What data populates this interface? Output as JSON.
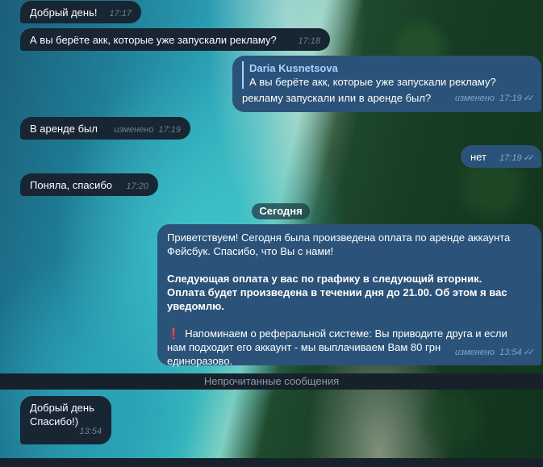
{
  "chat": {
    "messages_before": [
      {
        "text": "Добрый день!",
        "time": "17:17"
      },
      {
        "text": "А вы берёте акк, которые уже запускали рекламу?",
        "time": "17:18"
      }
    ],
    "reply_message": {
      "reply_author": "Daria Kusnetsova",
      "reply_text": "А вы берёте акк, которые уже запускали рекламу?",
      "text": "рекламу запускали или в аренде был?",
      "edited": "изменено",
      "time": "17:19",
      "ticks": "✓✓"
    },
    "in_rent": {
      "text": "В аренде был",
      "edited": "изменено",
      "time": "17:19"
    },
    "no": {
      "text": "нет",
      "time": "17:19",
      "ticks": "✓✓"
    },
    "thanks": {
      "text": "Поняла, спасибо",
      "time": "17:20"
    },
    "date_separator": "Сегодня",
    "long_message": {
      "paragraph1": "Приветствуем! Сегодня была произведена оплата по аренде аккаунта Фейсбук. Спасибо, что Вы с нами!",
      "paragraph1_line1": "Приветствуем! Сегодня была произведена оплата по аренде аккаунта",
      "paragraph1_line2": "Фейсбук. Спасибо, что Вы с нами!",
      "bold_line1": "Следующая оплата у вас по графику в следующий вторник.",
      "bold_line2": "Оплата будет произведена в течении дня до 21.00. Об этом я вас",
      "bold_line3": "уведомлю.",
      "warn_icon": "❗",
      "reminder_line1": "Напоминаем о реферальной системе: Вы приводите друга и если",
      "reminder_line2": "нам подходит его аккаунт - мы выплачиваем Вам 80 грн",
      "reminder_line3": "единоразово.",
      "edited": "изменено",
      "time": "13:54",
      "ticks": "✓✓"
    },
    "unread_label": "Непрочитанные сообщения",
    "last_message": {
      "line1": "Добрый день",
      "line2": "Спасибо!)",
      "time": "13:54"
    }
  },
  "colors": {
    "incoming_bubble": "#182533",
    "outgoing_bubble": "#2b5278",
    "reply_accent": "#a8d2ff",
    "unread_bar": "#17212b"
  }
}
